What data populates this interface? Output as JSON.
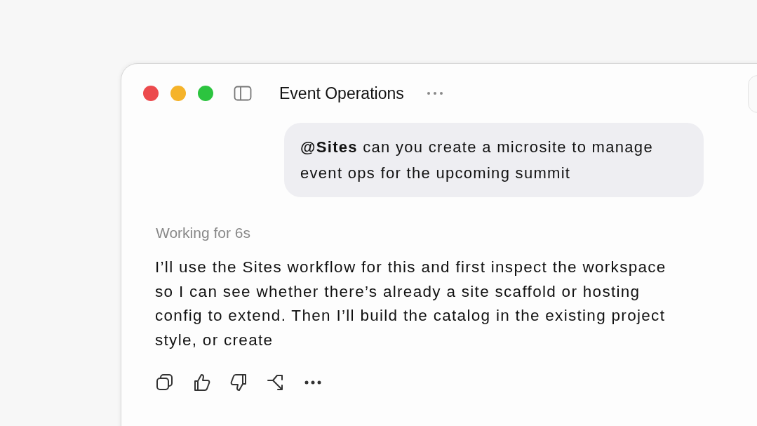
{
  "window": {
    "title": "Event Operations"
  },
  "user_message": {
    "text": "**@Sites** can you create a microsite to manage event ops for the upcoming summit"
  },
  "status": "Working for 6s",
  "response": "I’ll use the Sites workflow for this and first inspect the workspace so I can see whether there’s already a site scaffold or hosting config to extend. Then I’ll build the catalog in the existing project style, or create",
  "actions": [
    {
      "kind": "copy"
    },
    {
      "kind": "like"
    },
    {
      "kind": "dislike"
    },
    {
      "kind": "branch"
    },
    {
      "kind": "more"
    }
  ]
}
